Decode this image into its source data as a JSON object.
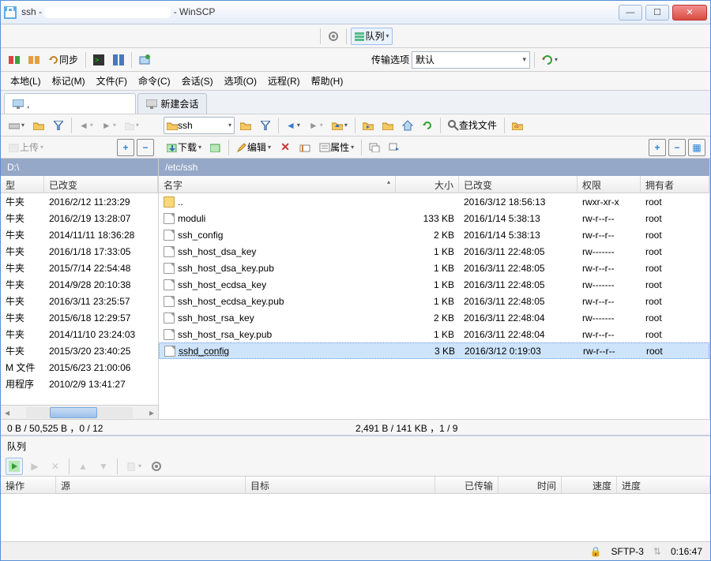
{
  "window": {
    "title_prefix": "ssh - ",
    "title_suffix": " - WinSCP"
  },
  "toolbar1": {
    "queue_label": "队列"
  },
  "toolbar2": {
    "sync_label": "同步",
    "transfer_options_label": "传输选项",
    "transfer_preset": "默认"
  },
  "menu": {
    "local": "本地(L)",
    "mark": "标记(M)",
    "files": "文件(F)",
    "commands": "命令(C)",
    "session": "会话(S)",
    "options": "选项(O)",
    "remote": "远程(R)",
    "help": "帮助(H)"
  },
  "session_tabs": {
    "active": ",",
    "new_session": "新建会话"
  },
  "nav": {
    "left_drive": "",
    "right_folder": "ssh",
    "find_files": "查找文件"
  },
  "filebar": {
    "upload": "上传",
    "download": "下载",
    "edit": "编辑",
    "properties": "属性"
  },
  "local_panel": {
    "path": "D:\\",
    "columns": {
      "type": "型",
      "changed": "已改变"
    },
    "rows": [
      {
        "type": "牛夹",
        "changed": "2016/2/12  11:23:29"
      },
      {
        "type": "牛夹",
        "changed": "2016/2/19  13:28:07"
      },
      {
        "type": "牛夹",
        "changed": "2014/11/11  18:36:28"
      },
      {
        "type": "牛夹",
        "changed": "2016/1/18  17:33:05"
      },
      {
        "type": "牛夹",
        "changed": "2015/7/14  22:54:48"
      },
      {
        "type": "牛夹",
        "changed": "2014/9/28  20:10:38"
      },
      {
        "type": "牛夹",
        "changed": "2016/3/11  23:25:57"
      },
      {
        "type": "牛夹",
        "changed": "2015/6/18  12:29:57"
      },
      {
        "type": "牛夹",
        "changed": "2014/11/10  23:24:03"
      },
      {
        "type": "牛夹",
        "changed": "2015/3/20  23:40:25"
      },
      {
        "type": "M 文件",
        "changed": "2015/6/23  21:00:06"
      },
      {
        "type": "用程序",
        "changed": "2010/2/9  13:41:27"
      }
    ],
    "status": "0 B / 50,525 B ，0 / 12"
  },
  "remote_panel": {
    "path": "/etc/ssh",
    "columns": {
      "name": "名字",
      "size": "大小",
      "changed": "已改变",
      "rights": "权限",
      "owner": "拥有者"
    },
    "rows": [
      {
        "name": "..",
        "size": "",
        "changed": "2016/3/12 18:56:13",
        "rights": "rwxr-xr-x",
        "owner": "root",
        "icon": "folder-up"
      },
      {
        "name": "moduli",
        "size": "133 KB",
        "changed": "2016/1/14 5:38:13",
        "rights": "rw-r--r--",
        "owner": "root",
        "icon": "file"
      },
      {
        "name": "ssh_config",
        "size": "2 KB",
        "changed": "2016/1/14 5:38:13",
        "rights": "rw-r--r--",
        "owner": "root",
        "icon": "file"
      },
      {
        "name": "ssh_host_dsa_key",
        "size": "1 KB",
        "changed": "2016/3/11 22:48:05",
        "rights": "rw-------",
        "owner": "root",
        "icon": "file"
      },
      {
        "name": "ssh_host_dsa_key.pub",
        "size": "1 KB",
        "changed": "2016/3/11 22:48:05",
        "rights": "rw-r--r--",
        "owner": "root",
        "icon": "file"
      },
      {
        "name": "ssh_host_ecdsa_key",
        "size": "1 KB",
        "changed": "2016/3/11 22:48:05",
        "rights": "rw-------",
        "owner": "root",
        "icon": "file"
      },
      {
        "name": "ssh_host_ecdsa_key.pub",
        "size": "1 KB",
        "changed": "2016/3/11 22:48:05",
        "rights": "rw-r--r--",
        "owner": "root",
        "icon": "file"
      },
      {
        "name": "ssh_host_rsa_key",
        "size": "2 KB",
        "changed": "2016/3/11 22:48:04",
        "rights": "rw-------",
        "owner": "root",
        "icon": "file"
      },
      {
        "name": "ssh_host_rsa_key.pub",
        "size": "1 KB",
        "changed": "2016/3/11 22:48:04",
        "rights": "rw-r--r--",
        "owner": "root",
        "icon": "file"
      },
      {
        "name": "sshd_config",
        "size": "3 KB",
        "changed": "2016/3/12 0:19:03",
        "rights": "rw-r--r--",
        "owner": "root",
        "icon": "file",
        "selected": true
      }
    ],
    "status": "2,491 B / 141 KB ，1 / 9"
  },
  "queue": {
    "title": "队列",
    "columns": {
      "op": "操作",
      "source": "源",
      "target": "目标",
      "transferred": "已传输",
      "time": "时间",
      "speed": "速度",
      "progress": "进度"
    }
  },
  "footer": {
    "protocol": "SFTP-3",
    "elapsed": "0:16:47"
  }
}
